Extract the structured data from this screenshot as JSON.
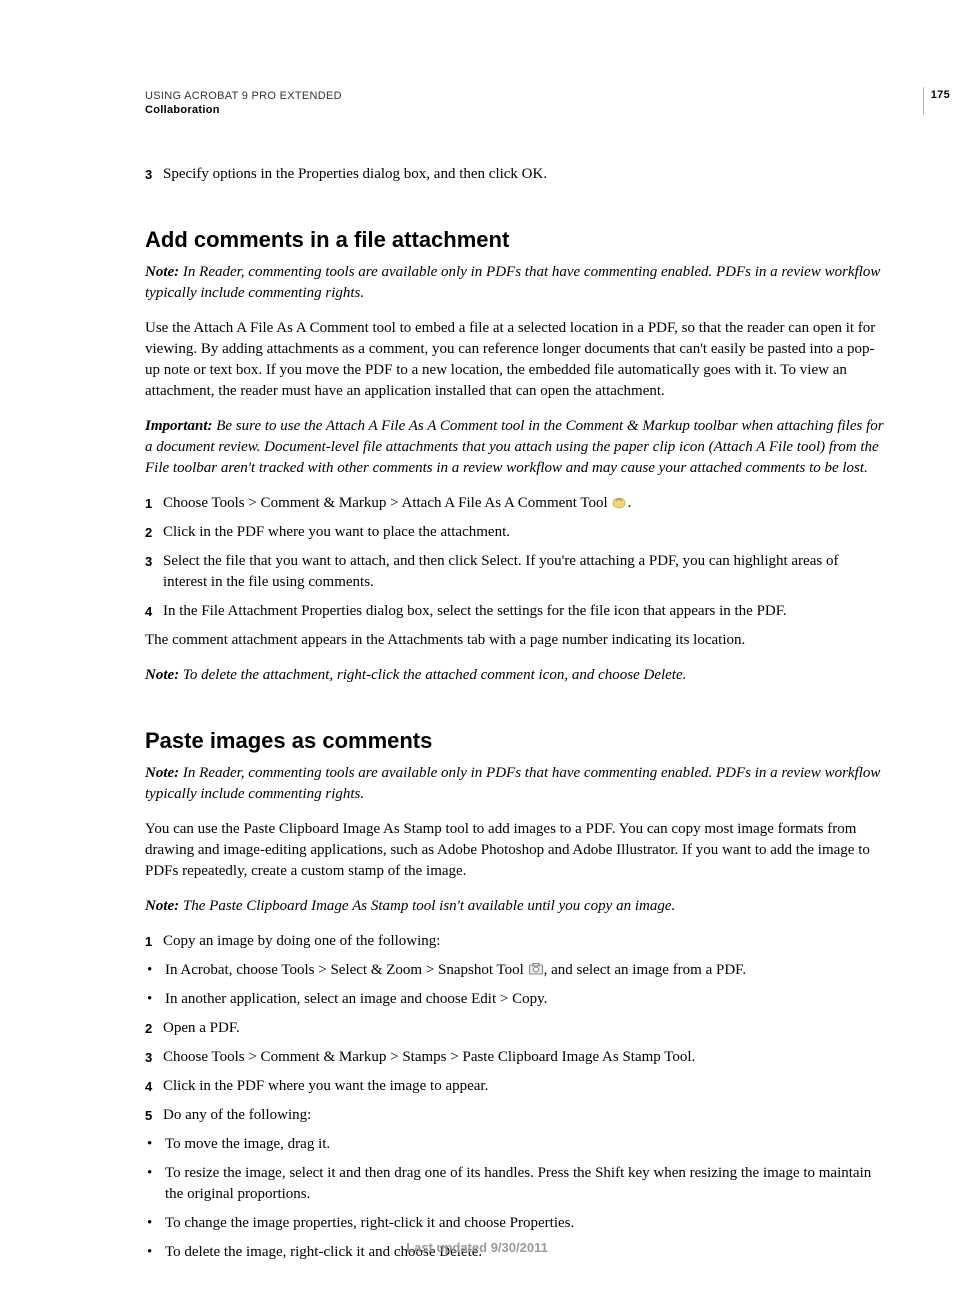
{
  "header": {
    "running_title": "USING ACROBAT 9 PRO EXTENDED",
    "section": "Collaboration",
    "page_number": "175"
  },
  "step_before": {
    "num": "3",
    "text": "Specify options in the Properties dialog box, and then click OK."
  },
  "section1": {
    "heading": "Add comments in a file attachment",
    "note1_label": "Note:",
    "note1_text": " In Reader, commenting tools are available only in PDFs that have commenting enabled. PDFs in a review workflow typically include commenting rights.",
    "para1": "Use the Attach A File As A Comment tool to embed a file at a selected location in a PDF, so that the reader can open it for viewing. By adding attachments as a comment, you can reference longer documents that can't easily be pasted into a pop-up note or text box. If you move the PDF to a new location, the embedded file automatically goes with it. To view an attachment, the reader must have an application installed that can open the attachment.",
    "important_label": "Important:",
    "important_text": " Be sure to use the Attach A File As A Comment tool in the Comment & Markup toolbar when attaching files for a document review. Document-level file attachments that you attach using the paper clip icon (Attach A File tool) from the File toolbar aren't tracked with other comments in a review workflow and may cause your attached comments to be lost.",
    "steps": {
      "s1_num": "1",
      "s1_text": "Choose Tools > Comment & Markup > Attach A File As A Comment Tool ",
      "s1_after": ".",
      "s2_num": "2",
      "s2_text": "Click in the PDF where you want to place the attachment.",
      "s3_num": "3",
      "s3_text": "Select the file that you want to attach, and then click Select. If you're attaching a PDF, you can highlight areas of interest in the file using comments.",
      "s4_num": "4",
      "s4_text": "In the File Attachment Properties dialog box, select the settings for the file icon that appears in the PDF."
    },
    "para2": "The comment attachment appears in the Attachments tab with a page number indicating its location.",
    "note2_label": "Note:",
    "note2_text": " To delete the attachment, right-click the attached comment icon, and choose Delete."
  },
  "section2": {
    "heading": "Paste images as comments",
    "note1_label": "Note:",
    "note1_text": " In Reader, commenting tools are available only in PDFs that have commenting enabled. PDFs in a review workflow typically include commenting rights.",
    "para1": "You can use the Paste Clipboard Image As Stamp tool to add images to a PDF. You can copy most image formats from drawing and image-editing applications, such as Adobe Photoshop and Adobe Illustrator. If you want to add the image to PDFs repeatedly, create a custom stamp of the image.",
    "note2_label": "Note:",
    "note2_text": " The Paste Clipboard Image As Stamp tool isn't available until you copy an image.",
    "steps": {
      "s1_num": "1",
      "s1_text": "Copy an image by doing one of the following:",
      "b1_text_before": "In Acrobat, choose Tools > Select & Zoom > Snapshot Tool ",
      "b1_text_after": ", and select an image from a PDF.",
      "b2_text": "In another application, select an image and choose Edit > Copy.",
      "s2_num": "2",
      "s2_text": "Open a PDF.",
      "s3_num": "3",
      "s3_text": "Choose Tools > Comment & Markup > Stamps > Paste Clipboard Image As Stamp Tool.",
      "s4_num": "4",
      "s4_text": "Click in the PDF where you want the image to appear.",
      "s5_num": "5",
      "s5_text": "Do any of the following:",
      "b3_text": "To move the image, drag it.",
      "b4_text": "To resize the image, select it and then drag one of its handles. Press the Shift key when resizing the image to maintain the original proportions.",
      "b5_text": "To change the image properties, right-click it and choose Properties.",
      "b6_text": "To delete the image, right-click it and choose Delete."
    }
  },
  "footer": "Last updated 9/30/2011"
}
